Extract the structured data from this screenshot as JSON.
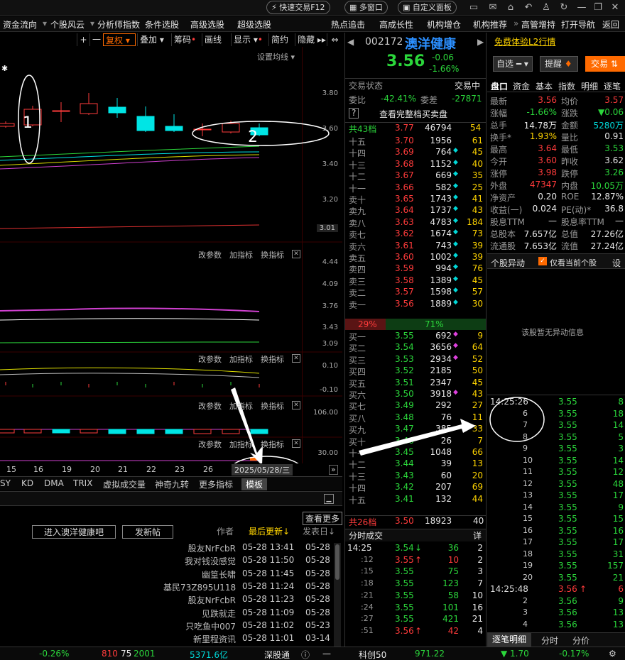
{
  "titlebar": {
    "quick_trade": "快速交易F12",
    "multi_window": "多窗口",
    "custom_panel": "自定义面板"
  },
  "menu": [
    "资金流向",
    "个股风云",
    "分析师指数",
    "条件选股",
    "高级选股",
    "超级选股",
    "热点追击",
    "高成长性",
    "机构增仓",
    "机构推荐",
    "高管增持",
    "打开导航",
    "返回"
  ],
  "chart_toolbar": {
    "plus": "+",
    "minus": "一",
    "fuquan": "复权",
    "overlay": "叠加",
    "chips": "筹码",
    "draw": "画线",
    "display": "显示",
    "simple": "简约",
    "hide": "隐藏",
    "ma_setting": "设置均线"
  },
  "price_axis": [
    "3.80",
    "3.60",
    "3.40",
    "3.20",
    "3.01"
  ],
  "pane2_axis": [
    "4.44",
    "4.09",
    "3.76",
    "3.43",
    "3.09"
  ],
  "pane3_axis": [
    "0.10",
    "-0.10"
  ],
  "pane4_axis": [
    "106.00"
  ],
  "pane5_axis": [
    "30.00"
  ],
  "pane_tools": {
    "change": "改参数",
    "add": "加指标",
    "switch": "换指标"
  },
  "annotations": {
    "one": "1",
    "two": "2"
  },
  "xaxis": {
    "labels": [
      "15",
      "16",
      "19",
      "20",
      "21",
      "22",
      "23",
      "26"
    ],
    "date": "2025/05/28/三"
  },
  "indicators": [
    "SY",
    "KD",
    "DMA",
    "TRIX",
    "虚拟成交量",
    "神奇九转",
    "更多指标",
    "模板"
  ],
  "forum": {
    "enter": "进入澳洋健康吧",
    "post": "发新帖",
    "more": "查看更多",
    "h_author": "作者",
    "h_updated": "最后更新↓",
    "h_posted": "发表日↓",
    "rows": [
      {
        "title": "",
        "author": "股友NrFcbR",
        "updated": "05-28 13:41",
        "posted": "05-28"
      },
      {
        "title": "",
        "author": "我对钱没感觉",
        "updated": "05-28 11:50",
        "posted": "05-28"
      },
      {
        "title": "",
        "author": "幽篁长啸",
        "updated": "05-28 11:45",
        "posted": "05-28"
      },
      {
        "title": "",
        "author": "基民73Z895U118",
        "updated": "05-28 11:24",
        "posted": "05-28"
      },
      {
        "title": "",
        "author": "股友NrFcbR",
        "updated": "05-28 11:23",
        "posted": "05-28"
      },
      {
        "title": "",
        "author": "见跌就走",
        "updated": "05-28 11:09",
        "posted": "05-28"
      },
      {
        "title": "",
        "author": "只吃鱼中007",
        "updated": "05-28 11:02",
        "posted": "05-23"
      },
      {
        "title": "",
        "author": "新里程资讯",
        "updated": "05-28 11:01",
        "posted": "03-14"
      }
    ]
  },
  "stock": {
    "code": "002172",
    "name": "澳洋健康",
    "price": "3.56",
    "chg": "-0.06",
    "pct": "-1.66%",
    "free_l2": "免费体验L2行情",
    "watch": "自选",
    "alert": "提醒",
    "trade": "交易"
  },
  "ob": {
    "status_label": "交易状态",
    "status_value": "交易中",
    "wb_label": "委比",
    "wb_value": "-42.41%",
    "wc_label": "委差",
    "wc_value": "-27871",
    "view_full": "查看完整档买卖盘",
    "sell_total": {
      "label": "共43档",
      "price": "3.77",
      "vol": "46794",
      "n": "54"
    },
    "sells": [
      {
        "l": "十五",
        "p": "3.70",
        "v": "1956",
        "n": "61",
        "m": ""
      },
      {
        "l": "十四",
        "p": "3.69",
        "v": "764",
        "n": "45",
        "m": "◆"
      },
      {
        "l": "十三",
        "p": "3.68",
        "v": "1152",
        "n": "40",
        "m": "◆"
      },
      {
        "l": "十二",
        "p": "3.67",
        "v": "669",
        "n": "35",
        "m": "◆"
      },
      {
        "l": "十一",
        "p": "3.66",
        "v": "582",
        "n": "25",
        "m": "◆"
      },
      {
        "l": "卖十",
        "p": "3.65",
        "v": "1743",
        "n": "41",
        "m": "◆"
      },
      {
        "l": "卖九",
        "p": "3.64",
        "v": "1737",
        "n": "43",
        "m": "◆"
      },
      {
        "l": "卖八",
        "p": "3.63",
        "v": "4783",
        "n": "184",
        "m": "◆"
      },
      {
        "l": "卖七",
        "p": "3.62",
        "v": "1674",
        "n": "73",
        "m": "◆"
      },
      {
        "l": "卖六",
        "p": "3.61",
        "v": "743",
        "n": "39",
        "m": "◆"
      },
      {
        "l": "卖五",
        "p": "3.60",
        "v": "1002",
        "n": "39",
        "m": "◆"
      },
      {
        "l": "卖四",
        "p": "3.59",
        "v": "994",
        "n": "76",
        "m": "◆"
      },
      {
        "l": "卖三",
        "p": "3.58",
        "v": "1389",
        "n": "45",
        "m": "◆"
      },
      {
        "l": "卖二",
        "p": "3.57",
        "v": "1598",
        "n": "57",
        "m": "◆"
      },
      {
        "l": "卖一",
        "p": "3.56",
        "v": "1889",
        "n": "30",
        "m": "◆"
      }
    ],
    "ratio": {
      "sell": "29%",
      "buy": "71%",
      "sell_frac": 0.29
    },
    "buys": [
      {
        "l": "买一",
        "p": "3.55",
        "v": "692",
        "n": "9",
        "m": "◆"
      },
      {
        "l": "买二",
        "p": "3.54",
        "v": "3656",
        "n": "64",
        "m": "◆"
      },
      {
        "l": "买三",
        "p": "3.53",
        "v": "2934",
        "n": "52",
        "m": "◆"
      },
      {
        "l": "买四",
        "p": "3.52",
        "v": "2185",
        "n": "50",
        "m": ""
      },
      {
        "l": "买五",
        "p": "3.51",
        "v": "2347",
        "n": "45",
        "m": ""
      },
      {
        "l": "买六",
        "p": "3.50",
        "v": "3918",
        "n": "43",
        "m": "◆"
      },
      {
        "l": "买七",
        "p": "3.49",
        "v": "292",
        "n": "27",
        "m": ""
      },
      {
        "l": "买八",
        "p": "3.48",
        "v": "76",
        "n": "11",
        "m": ""
      },
      {
        "l": "买九",
        "p": "3.47",
        "v": "385",
        "n": "33",
        "m": ""
      },
      {
        "l": "买十",
        "p": "3.46",
        "v": "26",
        "n": "7",
        "m": ""
      },
      {
        "l": "十一",
        "p": "3.45",
        "v": "1048",
        "n": "66",
        "m": ""
      },
      {
        "l": "十二",
        "p": "3.44",
        "v": "39",
        "n": "13",
        "m": ""
      },
      {
        "l": "十三",
        "p": "3.43",
        "v": "60",
        "n": "20",
        "m": ""
      },
      {
        "l": "十四",
        "p": "3.42",
        "v": "207",
        "n": "69",
        "m": ""
      },
      {
        "l": "十五",
        "p": "3.41",
        "v": "132",
        "n": "44",
        "m": ""
      }
    ],
    "buy_total": {
      "label": "共26档",
      "price": "3.50",
      "vol": "18923",
      "n": "40"
    },
    "ticks_title": "分时成交",
    "ticks_btn": "详",
    "ticks": [
      {
        "t": "14:25",
        "p": "3.54",
        "a": "↓",
        "v": "36",
        "n": "2"
      },
      {
        "t": ":12",
        "p": "3.55",
        "a": "↑",
        "v": "10",
        "n": "2"
      },
      {
        "t": ":15",
        "p": "3.55",
        "a": "",
        "v": "75",
        "n": "3"
      },
      {
        "t": ":18",
        "p": "3.55",
        "a": "",
        "v": "123",
        "n": "7"
      },
      {
        "t": ":21",
        "p": "3.55",
        "a": "",
        "v": "58",
        "n": "10"
      },
      {
        "t": ":24",
        "p": "3.55",
        "a": "",
        "v": "101",
        "n": "16"
      },
      {
        "t": ":27",
        "p": "3.55",
        "a": "",
        "v": "421",
        "n": "21"
      },
      {
        "t": ":51",
        "p": "3.56",
        "a": "↑",
        "v": "42",
        "n": "4"
      }
    ]
  },
  "rp": {
    "tabs": [
      "盘口",
      "资金",
      "基本",
      "指数",
      "明细",
      "逐笔"
    ],
    "quote": [
      [
        "最新",
        "3.56",
        "均价",
        "3.57"
      ],
      [
        "涨幅",
        "-1.66%",
        "涨跌",
        "▼0.06"
      ],
      [
        "总手",
        "14.78万",
        "金额",
        "5280万"
      ],
      [
        "换手*",
        "1.93%",
        "量比",
        "0.91"
      ],
      [
        "最高",
        "3.64",
        "最低",
        "3.53"
      ],
      [
        "今开",
        "3.60",
        "昨收",
        "3.62"
      ],
      [
        "涨停",
        "3.98",
        "跌停",
        "3.26"
      ],
      [
        "外盘",
        "47347",
        "内盘",
        "10.05万"
      ],
      [
        "净资产",
        "0.20",
        "ROE",
        "12.87%"
      ],
      [
        "收益(一)",
        "0.024",
        "PE(动)*",
        "36.8"
      ],
      [
        "股息TTM",
        "—",
        "股息率TTM",
        "—"
      ],
      [
        "总股本",
        "7.657亿",
        "总值",
        "27.26亿"
      ],
      [
        "流通股",
        "7.653亿",
        "流值",
        "27.24亿"
      ]
    ],
    "anomaly_title": "个股异动",
    "anomaly_check": "仅看当前个股",
    "anomaly_set": "设",
    "anomaly_empty": "该股暂无异动信息",
    "trades": [
      {
        "t": "14:25:26",
        "p": "3.55",
        "a": "",
        "v": "8"
      },
      {
        "t": "6",
        "p": "3.55",
        "a": "",
        "v": "18"
      },
      {
        "t": "7",
        "p": "3.55",
        "a": "",
        "v": "14"
      },
      {
        "t": "8",
        "p": "3.55",
        "a": "",
        "v": "5"
      },
      {
        "t": "9",
        "p": "3.55",
        "a": "",
        "v": "3"
      },
      {
        "t": "10",
        "p": "3.55",
        "a": "",
        "v": "14"
      },
      {
        "t": "11",
        "p": "3.55",
        "a": "",
        "v": "12"
      },
      {
        "t": "12",
        "p": "3.55",
        "a": "",
        "v": "48"
      },
      {
        "t": "13",
        "p": "3.55",
        "a": "",
        "v": "17"
      },
      {
        "t": "14",
        "p": "3.55",
        "a": "",
        "v": "9"
      },
      {
        "t": "15",
        "p": "3.55",
        "a": "",
        "v": "15"
      },
      {
        "t": "16",
        "p": "3.55",
        "a": "",
        "v": "16"
      },
      {
        "t": "17",
        "p": "3.55",
        "a": "",
        "v": "17"
      },
      {
        "t": "18",
        "p": "3.55",
        "a": "",
        "v": "31"
      },
      {
        "t": "19",
        "p": "3.55",
        "a": "",
        "v": "157"
      },
      {
        "t": "20",
        "p": "3.55",
        "a": "",
        "v": "21"
      },
      {
        "t": "14:25:48",
        "p": "3.56",
        "a": "↑",
        "v": "6"
      },
      {
        "t": "2",
        "p": "3.56",
        "a": "",
        "v": "9"
      },
      {
        "t": "3",
        "p": "3.56",
        "a": "",
        "v": "13"
      },
      {
        "t": "4",
        "p": "3.56",
        "a": "",
        "v": "13"
      }
    ],
    "bottom_tabs": [
      "逐笔明细",
      "分时",
      "分价"
    ]
  },
  "statusbar": {
    "sh_pct": "-0.26%",
    "up": "810",
    "flat": "75",
    "down": "2001",
    "amount": "5371.6亿",
    "sgt": "深股通",
    "sgt_val": "—",
    "kc50": "科创50",
    "kc_val": "971.22",
    "kc_chg": "▼ 1.70",
    "kc_pct": "-0.17%"
  },
  "colors": {
    "up": "#ff3b3b",
    "down": "#2bd63b",
    "accent": "#ff6a00",
    "link": "#ffd400"
  }
}
